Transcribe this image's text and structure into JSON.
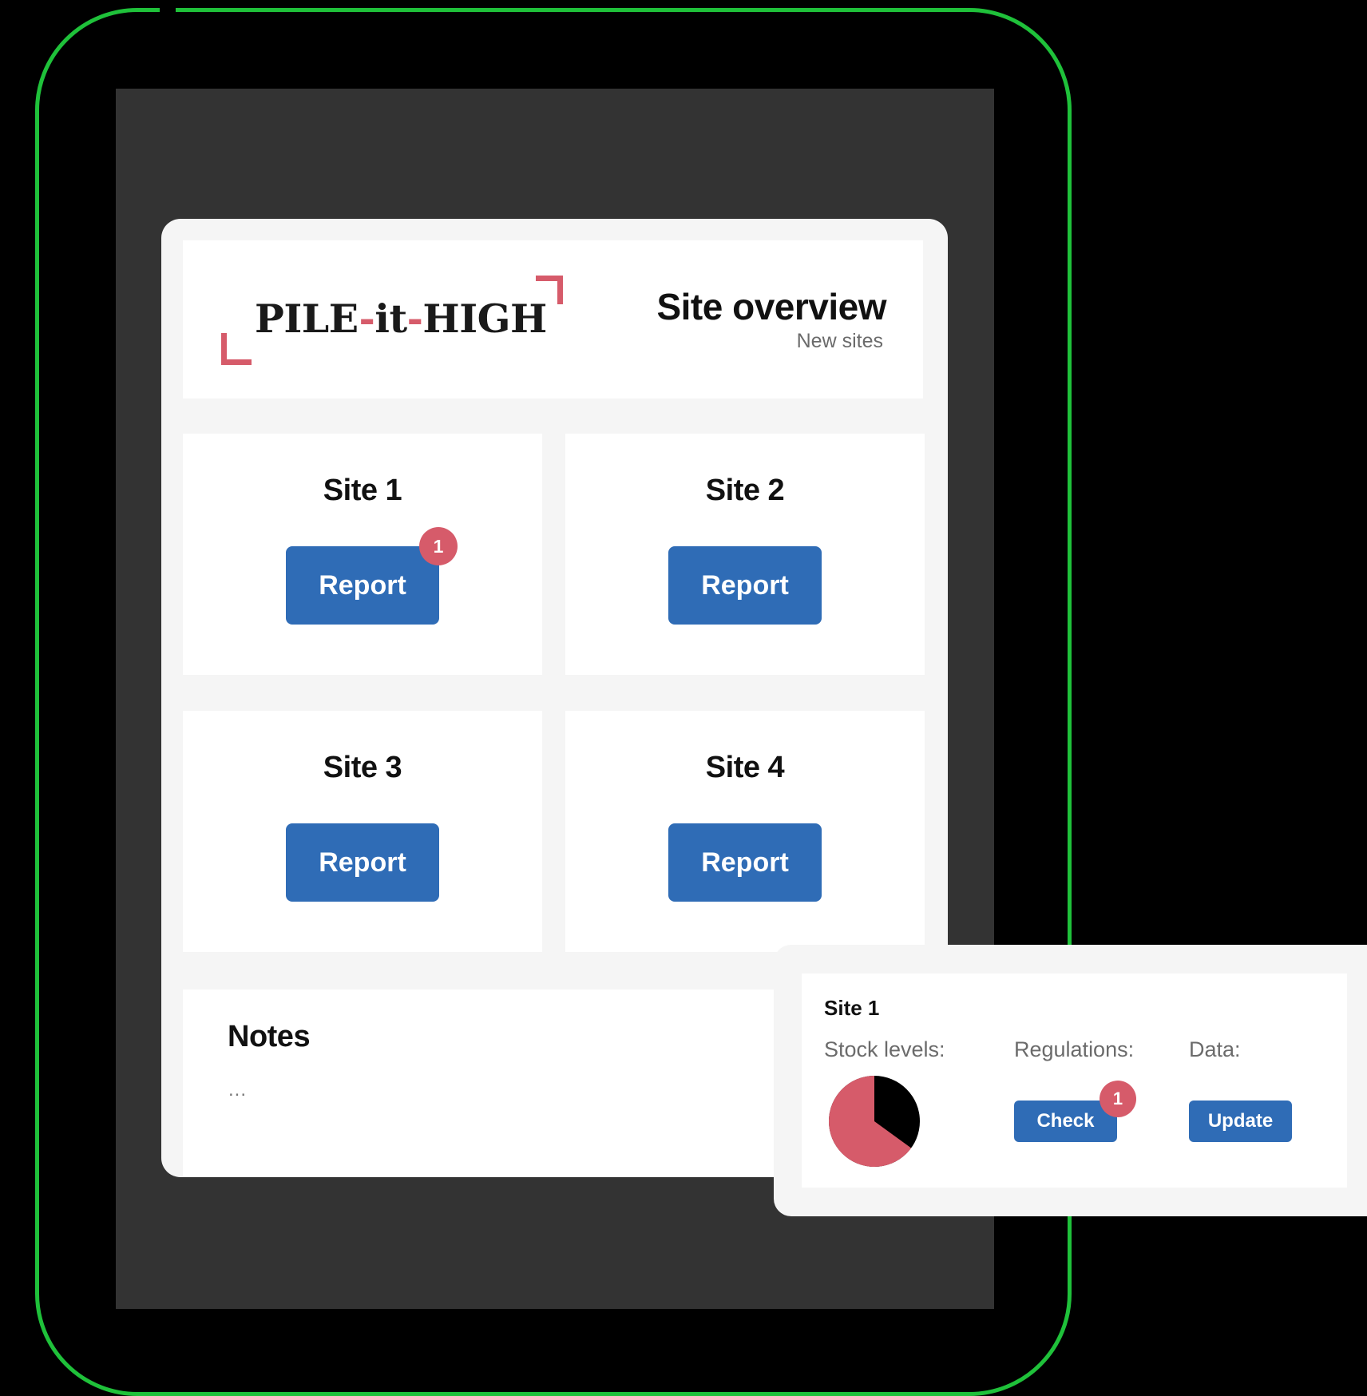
{
  "header": {
    "logo": {
      "part1": "PILE",
      "dash1": "-",
      "part2": "it",
      "dash2": "-",
      "part3": "HIGH"
    },
    "title": "Site overview",
    "subtitle": "New sites"
  },
  "sites": [
    {
      "name": "Site 1",
      "button_label": "Report",
      "badge": "1"
    },
    {
      "name": "Site 2",
      "button_label": "Report"
    },
    {
      "name": "Site 3",
      "button_label": "Report"
    },
    {
      "name": "Site 4",
      "button_label": "Report"
    }
  ],
  "notes": {
    "title": "Notes",
    "body": "..."
  },
  "detail_popup": {
    "title": "Site 1",
    "stock_label": "Stock levels:",
    "regulations_label": "Regulations:",
    "data_label": "Data:",
    "check_label": "Check",
    "check_badge": "1",
    "update_label": "Update",
    "stock_pie": {
      "filled_fraction": 0.65,
      "filled_color": "#d65b6a",
      "remaining_color": "#000000"
    }
  },
  "colors": {
    "accent": "#2f6cb6",
    "badge": "#d65b6a",
    "frame": "#1fc13a"
  }
}
